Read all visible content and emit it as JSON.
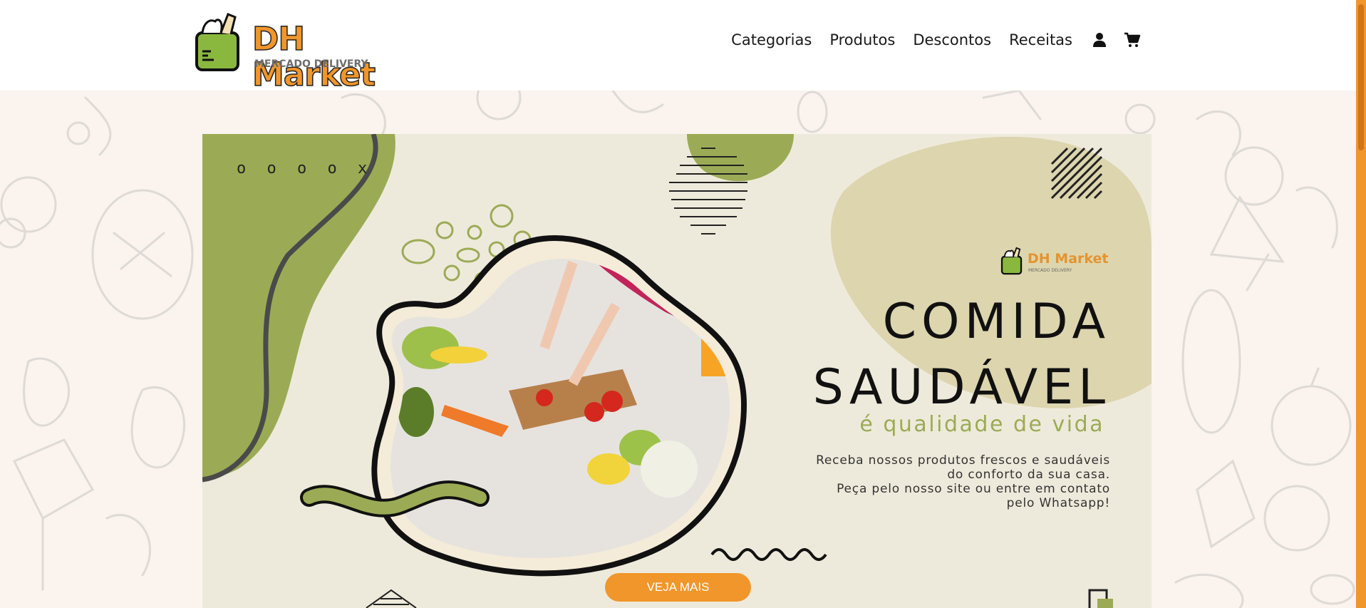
{
  "header": {
    "logo": {
      "title": "DH Market",
      "subtitle": "MERCADO DELIVERY"
    },
    "nav": [
      "Categorias",
      "Produtos",
      "Descontos",
      "Receitas"
    ],
    "icons": [
      "user-icon",
      "cart-icon"
    ]
  },
  "banner": {
    "brand": "DH Market",
    "brand_sub": "MERCADO DELIVERY",
    "title_line1": "COMIDA",
    "title_line2": "SAUDÁVEL",
    "subtitle": "é qualidade de vida",
    "desc_line1": "Receba nossos produtos frescos e saudáveis",
    "desc_line2": "do conforto da sua casa.",
    "desc_line3": "Peça pelo nosso site ou entre em contato",
    "desc_line4": "pelo Whatsapp!",
    "decor_marks": "o o o o x"
  },
  "cta": {
    "label": "VEJA MAIS"
  },
  "colors": {
    "accent": "#f0962a",
    "green": "#8ab83f",
    "olive": "#9bab55",
    "banner_bg": "#eeeadb"
  }
}
